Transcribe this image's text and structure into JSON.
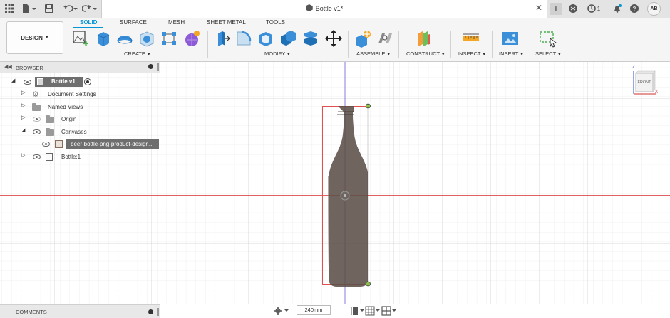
{
  "document": {
    "title": "Bottle v1*"
  },
  "topbar": {
    "notification_count": "1",
    "user_initials": "AB"
  },
  "workspace": {
    "mode_label": "DESIGN",
    "tabs": [
      "SOLID",
      "SURFACE",
      "MESH",
      "SHEET METAL",
      "TOOLS"
    ],
    "active_tab": "SOLID"
  },
  "groups": {
    "create": "CREATE",
    "modify": "MODIFY",
    "assemble": "ASSEMBLE",
    "construct": "CONSTRUCT",
    "inspect": "INSPECT",
    "insert": "INSERT",
    "select": "SELECT"
  },
  "browser": {
    "title": "BROWSER",
    "items": [
      {
        "label": "Bottle v1"
      },
      {
        "label": "Document Settings"
      },
      {
        "label": "Named Views"
      },
      {
        "label": "Origin"
      },
      {
        "label": "Canvases"
      },
      {
        "label": "beer-bottle-png-product-desigr..."
      },
      {
        "label": "Bottle:1"
      }
    ]
  },
  "comments": {
    "title": "COMMENTS"
  },
  "viewcube": {
    "face": "FRONT",
    "axis_z": "Z",
    "axis_x": "X"
  },
  "navbar": {
    "zoom_value": "240mm"
  },
  "colors": {
    "accent": "#0696d7",
    "bottle": "#5c4f48",
    "axis_red": "#e06060",
    "axis_purple": "#8a7be0",
    "grid": "#dcdcdc"
  }
}
